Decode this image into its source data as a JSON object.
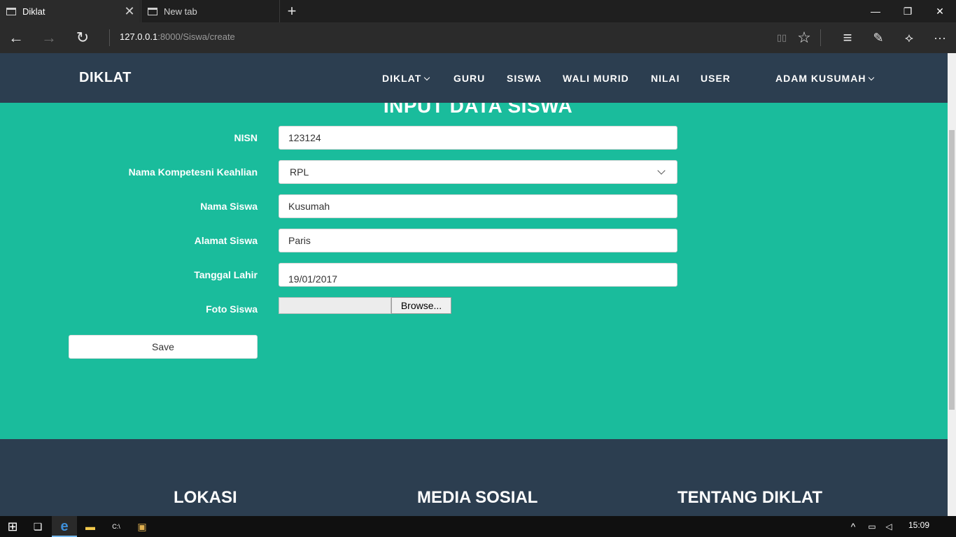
{
  "browser": {
    "tabs": [
      {
        "label": "Diklat",
        "close_glyph": "✕"
      },
      {
        "label": "New tab"
      }
    ],
    "newtab_glyph": "+",
    "window_controls": {
      "minimize": "—",
      "restore": "❐",
      "close": "✕"
    },
    "url_host": "127.0.0.1",
    "url_path": ":8000/Siswa/create",
    "nav": {
      "back": "←",
      "forward": "→",
      "refresh": "↻"
    },
    "tools": {
      "reading_view": "▯▯",
      "favorite": "☆",
      "hub": "≡",
      "notes": "✎",
      "share": "⟡",
      "more": "···"
    }
  },
  "site": {
    "brand": "DIKLAT",
    "menu": [
      {
        "label": "DIKLAT",
        "dropdown": true
      },
      {
        "label": "GURU"
      },
      {
        "label": "SISWA"
      },
      {
        "label": "WALI MURID"
      },
      {
        "label": "NILAI"
      },
      {
        "label": "USER"
      }
    ],
    "user_menu": "ADAM KUSUMAH"
  },
  "page": {
    "title": "INPUT DATA SISWA",
    "form": {
      "nisn": {
        "label": "NISN",
        "value": "123124"
      },
      "kompetensi": {
        "label": "Nama Kompetesni Keahlian",
        "value": "RPL"
      },
      "nama": {
        "label": "Nama Siswa",
        "value": "Kusumah"
      },
      "alamat": {
        "label": "Alamat Siswa",
        "value": "Paris"
      },
      "tanggal": {
        "label": "Tanggal Lahir",
        "value": "19/01/2017"
      },
      "foto": {
        "label": "Foto Siswa",
        "button": "Browse..."
      },
      "save": "Save"
    }
  },
  "footer": {
    "headings": [
      "LOKASI",
      "MEDIA SOSIAL",
      "TENTANG DIKLAT"
    ]
  },
  "taskbar": {
    "start": "⊞",
    "task_view": "❏",
    "edge": "e",
    "explorer": "▬",
    "cmd": "C:\\",
    "app": "▣",
    "tray_up": "^",
    "clock": "15:09"
  },
  "colors": {
    "accent": "#1abc9c",
    "navbar": "#2c3e50"
  }
}
